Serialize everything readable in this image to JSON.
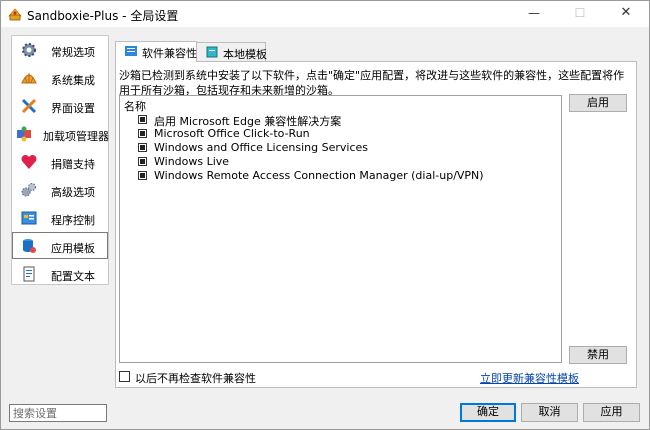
{
  "window": {
    "title": "Sandboxie-Plus - 全局设置",
    "minimize": "—",
    "maximize": "☐",
    "close": "✕"
  },
  "sidebar": {
    "items": [
      {
        "label": "常规选项",
        "icon": "gear-icon"
      },
      {
        "label": "系统集成",
        "icon": "shell-icon"
      },
      {
        "label": "界面设置",
        "icon": "tools-icon"
      },
      {
        "label": "加载项管理器",
        "icon": "puzzle-icon"
      },
      {
        "label": "捐赠支持",
        "icon": "heart-icon"
      },
      {
        "label": "高级选项",
        "icon": "gears-icon"
      },
      {
        "label": "程序控制",
        "icon": "program-icon"
      },
      {
        "label": "应用模板",
        "icon": "database-icon",
        "selected": true
      },
      {
        "label": "配置文本",
        "icon": "document-icon"
      }
    ]
  },
  "tabs": [
    {
      "label": "软件兼容性",
      "active": true
    },
    {
      "label": "本地模板",
      "active": false
    }
  ],
  "compat": {
    "description": "沙箱已检测到系统中安装了以下软件，点击\"确定\"应用配置，将改进与这些软件的兼容性，这些配置将作用于所有沙箱，包括现存和未来新增的沙箱。",
    "header": "名称",
    "items": [
      {
        "label": "启用 Microsoft Edge 兼容性解决方案",
        "checked": true
      },
      {
        "label": "Microsoft Office Click-to-Run",
        "checked": true
      },
      {
        "label": "Windows and Office Licensing Services",
        "checked": true
      },
      {
        "label": "Windows Live",
        "checked": true
      },
      {
        "label": "Windows Remote Access Connection Manager (dial-up/VPN)",
        "checked": true
      }
    ],
    "enable_button": "启用",
    "disable_button": "禁用",
    "no_check_label": "以后不再检查软件兼容性",
    "no_check_checked": false,
    "update_link": "立即更新兼容性模板"
  },
  "footer": {
    "search_placeholder": "搜索设置",
    "ok": "确定",
    "cancel": "取消",
    "apply": "应用"
  },
  "colors": {
    "accent": "#0078d7",
    "link": "#0645ad"
  }
}
